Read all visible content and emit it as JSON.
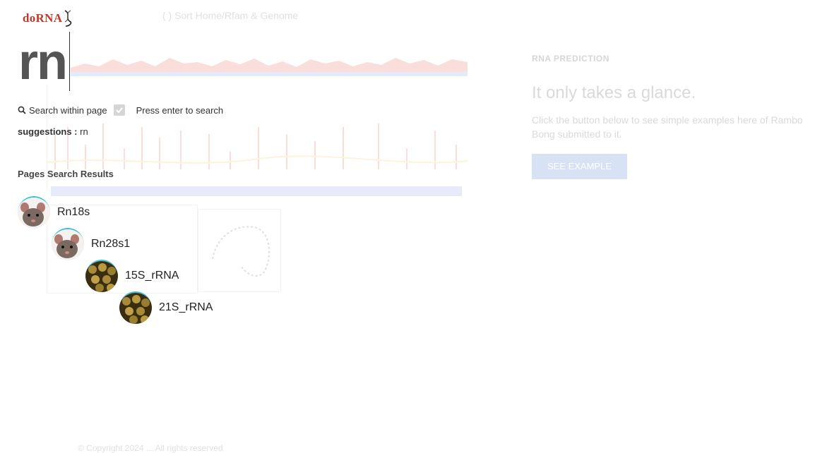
{
  "background": {
    "breadcrumb": "( ) Sort Home/Rfam & Genome",
    "eyebrow": "RNA PREDICTION",
    "hero_title": "It only takes a glance.",
    "hero_sub": "Click the button below to see simple examples here of Rambo Bong submitted to it.",
    "hero_button": "SEE EXAMPLE",
    "footer": "© Copyright 2024 ... All rights reserved"
  },
  "logo": {
    "text": "doRNA"
  },
  "search": {
    "query": "rn",
    "within_page_label": "Search within page",
    "within_page_checked": true,
    "press_enter_label": "Press enter to search"
  },
  "suggestions": {
    "label": "suggestions :",
    "value": "rn"
  },
  "results": {
    "heading": "Pages Search Results",
    "items": [
      {
        "label": "Rn18s",
        "avatar": "rat"
      },
      {
        "label": "Rn28s1",
        "avatar": "rat"
      },
      {
        "label": "15S_rRNA",
        "avatar": "yeast"
      },
      {
        "label": "21S_rRNA",
        "avatar": "yeast"
      }
    ]
  },
  "icons": {
    "search": "search-icon",
    "check": "check-icon",
    "dna": "dna-helix-icon"
  }
}
